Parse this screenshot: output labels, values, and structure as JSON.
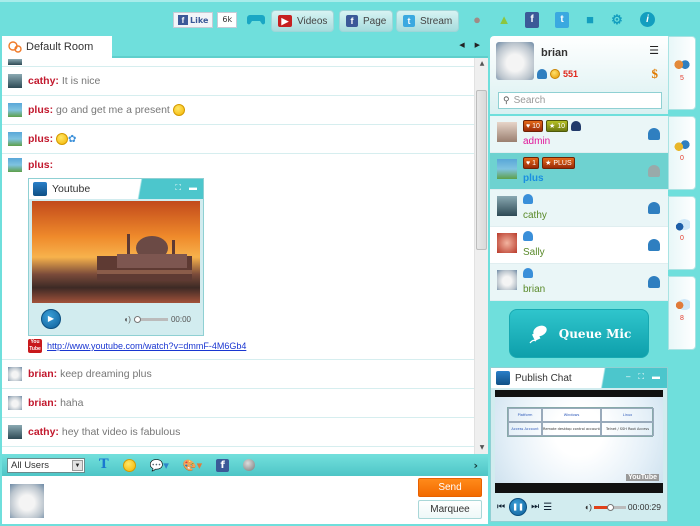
{
  "topbar": {
    "fb_like_label": "Like",
    "fb_like_count": "6k",
    "buttons": [
      {
        "label": "Videos",
        "icon": "youtube-icon"
      },
      {
        "label": "Page",
        "icon": "facebook-icon"
      },
      {
        "label": "Stream",
        "icon": "twitter-icon"
      }
    ],
    "icons": [
      "apple-icon",
      "android-icon",
      "facebook-add-icon",
      "twitter-add-icon",
      "gift-icon",
      "gear-icon",
      "info-icon"
    ]
  },
  "room": {
    "tab_label": "Default Room",
    "prev_arrow": "◀",
    "next_arrow": "▶"
  },
  "messages": [
    {
      "user": "cathy:",
      "text": "It is nice",
      "avatar": "cathy"
    },
    {
      "user": "plus:",
      "text": "go and get me a present",
      "avatar": "plus",
      "emoji": "smile"
    },
    {
      "user": "plus:",
      "text": "",
      "avatar": "plus",
      "emoji": "wink-flower"
    },
    {
      "user": "brian:",
      "text": "keep dreaming plus",
      "avatar": "brian"
    },
    {
      "user": "brian:",
      "text": "haha",
      "avatar": "brian"
    },
    {
      "user": "cathy:",
      "text": "hey that video is fabulous",
      "avatar": "cathy"
    }
  ],
  "youtube_message": {
    "user": "plus:",
    "player_title": "Youtube",
    "time": "00:00",
    "link": "http://www.youtube.com/watch?v=dmmF-4M6Gb4"
  },
  "composer": {
    "recipient": "All Users",
    "send_label": "Send",
    "marquee_label": "Marquee",
    "expand": "›"
  },
  "profile": {
    "name": "brian",
    "points": "551",
    "search_placeholder": "Search"
  },
  "users": [
    {
      "name": "admin",
      "name_color": "#e0189a",
      "badges": [
        "10",
        "10"
      ],
      "extra": "admin-icon",
      "status": "online",
      "row": "light"
    },
    {
      "name": "plus",
      "name_color": "#1a8fe0",
      "badges": [
        "1",
        "PLUS"
      ],
      "status": "away",
      "row": "selected"
    },
    {
      "name": "cathy",
      "name_color": "#5a8a2a",
      "badges": [],
      "status": "online",
      "row": "light"
    },
    {
      "name": "Sally",
      "name_color": "#5a8a2a",
      "badges": [],
      "status": "online",
      "row": "white"
    },
    {
      "name": "brian",
      "name_color": "#5a8a2a",
      "badges": [],
      "status": "online",
      "row": "light"
    }
  ],
  "side_tabs": [
    {
      "icon": "users-icon",
      "count": "5"
    },
    {
      "icon": "friends-icon",
      "count": "0"
    },
    {
      "icon": "webcam-chat-icon",
      "count": "0"
    },
    {
      "icon": "private-chat-icon",
      "count": "8"
    }
  ],
  "queue_mic": {
    "label": "Queue Mic"
  },
  "publish_chat": {
    "title": "Publish Chat",
    "time": "00:00:29",
    "volume_level": 0.5,
    "slide": {
      "headers": [
        "Platform",
        "Windows",
        "Linux"
      ],
      "row": [
        "Access Account",
        "Remote desktop control account",
        "Telnet / SSH Root Access"
      ],
      "watermark": "YouTube"
    }
  },
  "colors": {
    "background": "#6fdfdc",
    "username": "#c2182d",
    "send": "#f26a00",
    "accent": "#4cc6cc"
  }
}
